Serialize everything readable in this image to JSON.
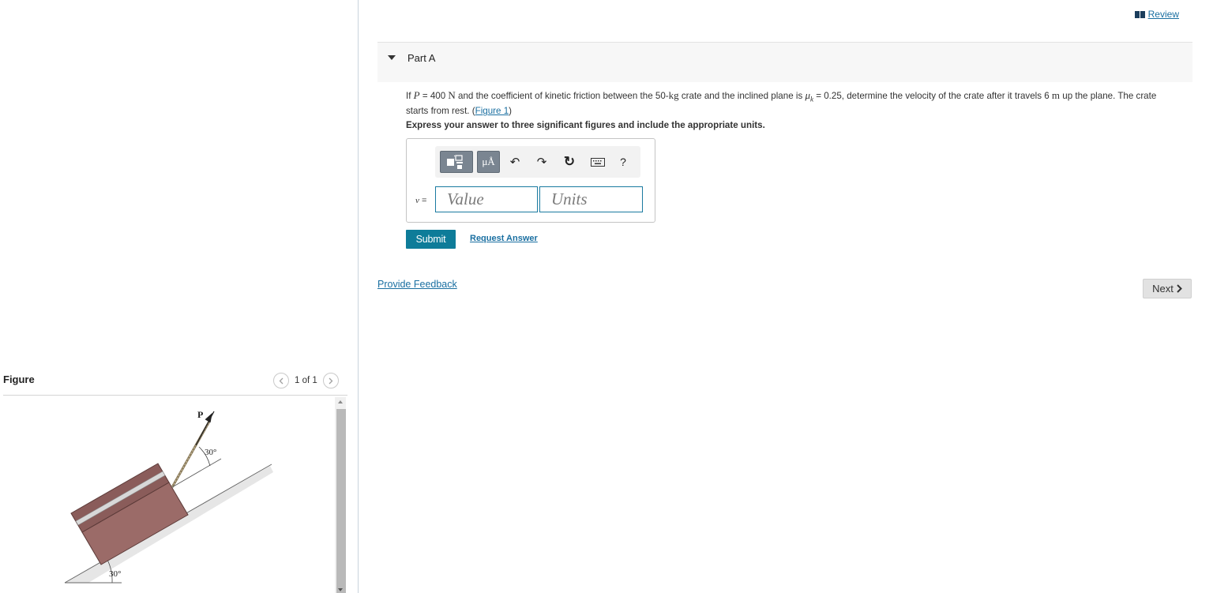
{
  "header": {
    "review_label": "Review"
  },
  "part": {
    "title": "Part A",
    "problem": {
      "t1": "If ",
      "P": "P",
      "t2": " = 400 ",
      "N": "N",
      "t3": " and the coefficient of kinetic friction between the 50-",
      "kg": "kg",
      "t4": " crate and the inclined plane is ",
      "mu": "μ",
      "k": "k",
      "t5": " = 0.25, determine the velocity of the crate after it travels 6 ",
      "m": "m",
      "t6": " up the plane. The crate starts from rest. (",
      "figure_link": "Figure 1",
      "t7": ")"
    },
    "instruction": "Express your answer to three significant figures and include the appropriate units.",
    "toolbar": {
      "units_btn": "μÅ",
      "undo": "↶",
      "redo": "↷",
      "reset": "↻",
      "help": "?"
    },
    "answer": {
      "var": "v",
      "eq": " =",
      "value_placeholder": "Value",
      "units_placeholder": "Units"
    },
    "submit_label": "Submit",
    "request_label": "Request Answer"
  },
  "footer": {
    "feedback_label": "Provide Feedback",
    "next_label": "Next"
  },
  "figure": {
    "title": "Figure",
    "pager": "1 of 1",
    "label_P": "P",
    "angle_top": "30°",
    "angle_bottom": "30°"
  },
  "colors": {
    "link": "#1a6fa1",
    "submit_bg": "#0e7c99",
    "crate": "#9b6b68"
  }
}
